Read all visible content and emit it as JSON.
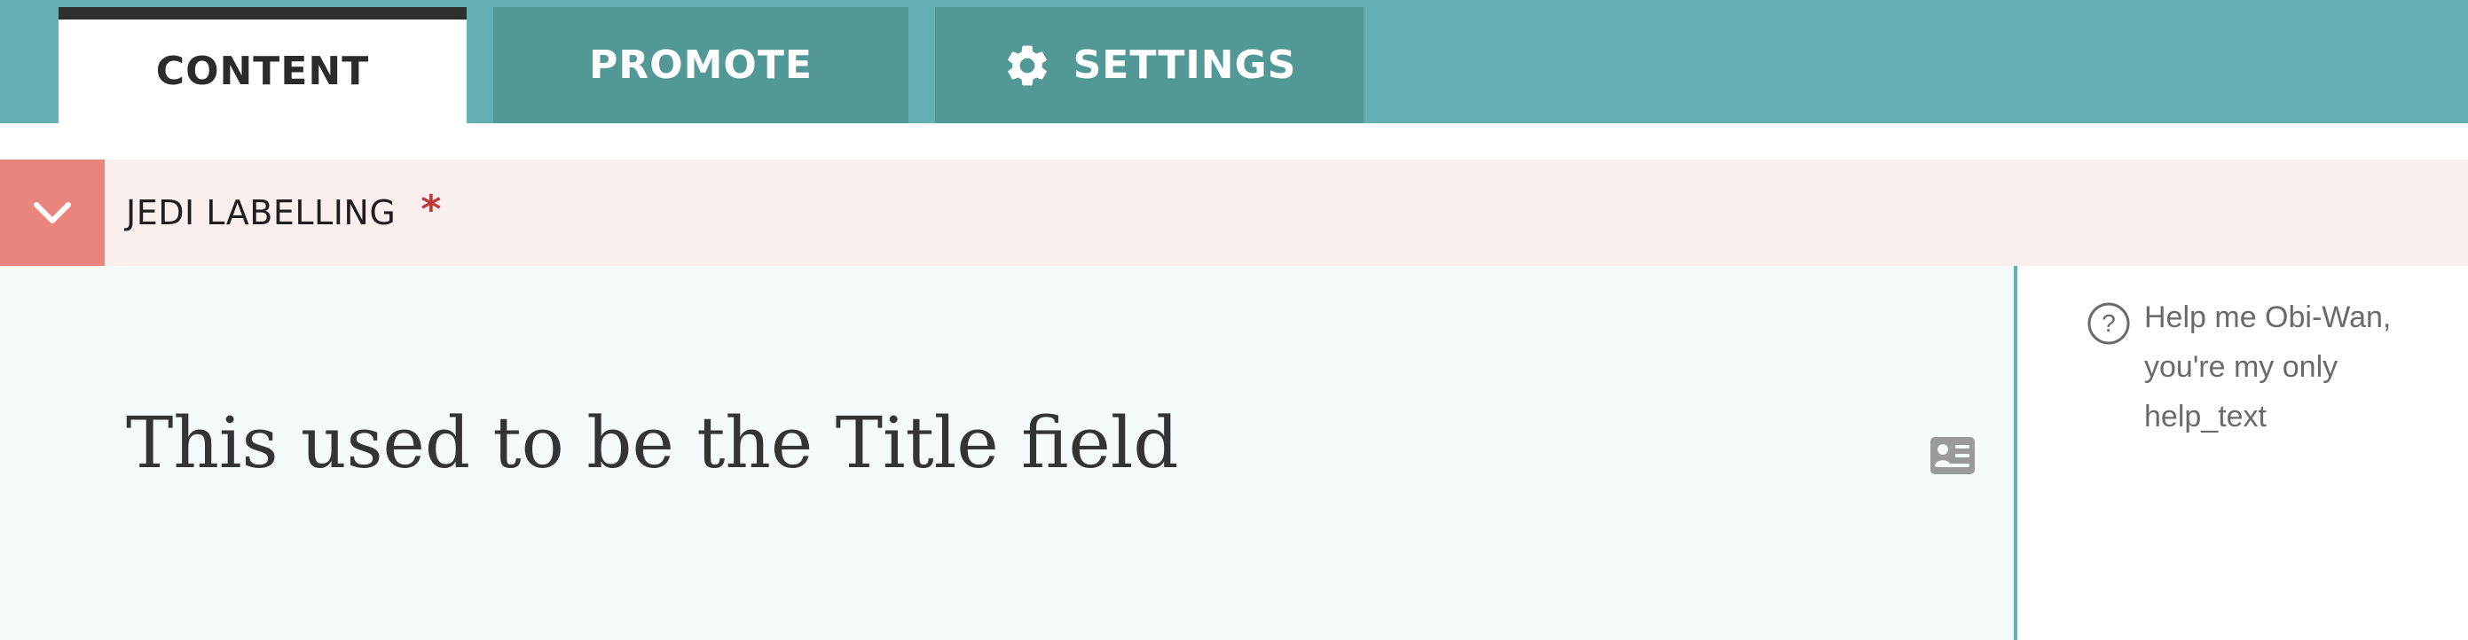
{
  "tabs": [
    {
      "label": "CONTENT",
      "active": true
    },
    {
      "label": "PROMOTE",
      "active": false
    },
    {
      "label": "SETTINGS",
      "active": false,
      "icon": "gear-icon"
    }
  ],
  "section": {
    "label": "JEDI LABELLING",
    "required_mark": "*",
    "collapse_icon": "chevron-down-icon"
  },
  "field": {
    "title_text": "This used to be the Title field",
    "side_icon": "contact-card-icon"
  },
  "help": {
    "icon": "question-circle-icon",
    "text": "Help me Obi-Wan, you're my only help_text"
  },
  "colors": {
    "tabbar_bg": "#63b0b3",
    "tab_inactive_bg": "#529896",
    "tab_active_bg": "#ffffff",
    "tab_active_topbar": "#2f2f2f",
    "section_bg": "#fbefee",
    "collapse_btn_bg": "#e9857d",
    "required": "#c0393b",
    "field_bg": "#f5fbfa",
    "divider": "#5bb3b6"
  }
}
